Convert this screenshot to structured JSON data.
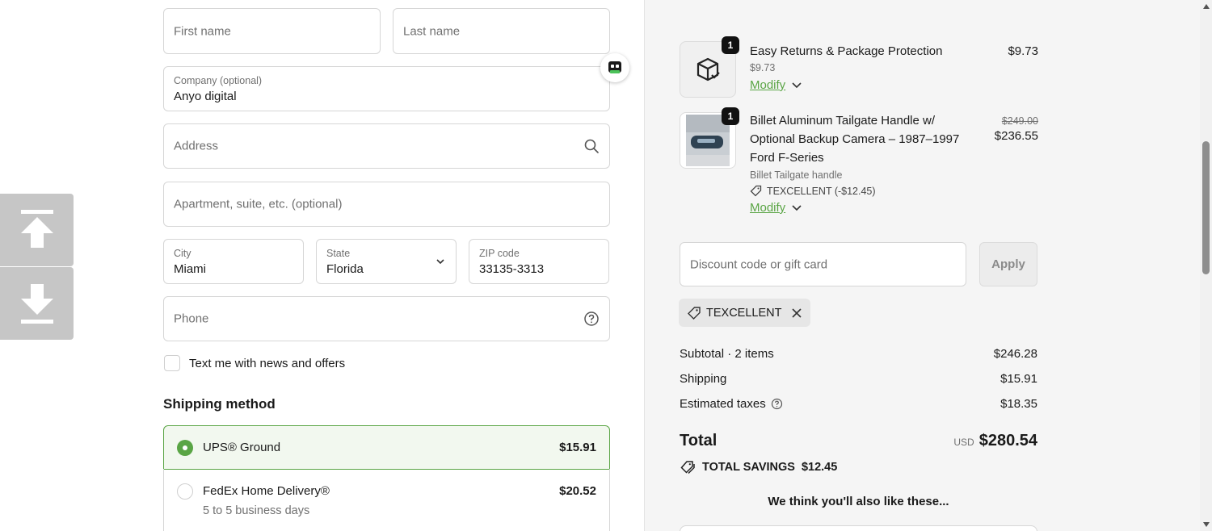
{
  "form": {
    "first_name": {
      "placeholder": "First name"
    },
    "last_name": {
      "placeholder": "Last name"
    },
    "company": {
      "label": "Company (optional)",
      "value": "Anyo digital"
    },
    "address": {
      "placeholder": "Address"
    },
    "apartment": {
      "placeholder": "Apartment, suite, etc. (optional)"
    },
    "city": {
      "label": "City",
      "value": "Miami"
    },
    "state": {
      "label": "State",
      "value": "Florida"
    },
    "zip": {
      "label": "ZIP code",
      "value": "33135-3313"
    },
    "phone": {
      "placeholder": "Phone"
    },
    "news_opt_in": {
      "label": "Text me with news and offers",
      "checked": false
    }
  },
  "shipping": {
    "title": "Shipping method",
    "options": [
      {
        "name": "UPS® Ground",
        "price": "$15.91",
        "selected": true
      },
      {
        "name": "FedEx Home Delivery®",
        "sub": "5 to 5 business days",
        "price": "$20.52",
        "selected": false
      }
    ]
  },
  "summary": {
    "items": [
      {
        "qty": "1",
        "name": "Easy Returns & Package Protection",
        "variant": "$9.73",
        "price": "$9.73",
        "modify": "Modify",
        "icon": "package-icon"
      },
      {
        "qty": "1",
        "name": "Billet Aluminum Tailgate Handle w/ Optional Backup Camera – 1987–1997 Ford F-Series",
        "variant": "Billet Tailgate handle",
        "discount": "TEXCELLENT (-$12.45)",
        "old_price": "$249.00",
        "price": "$236.55",
        "modify": "Modify"
      }
    ],
    "discount_placeholder": "Discount code or gift card",
    "apply_label": "Apply",
    "applied_code": "TEXCELLENT",
    "subtotal_label": "Subtotal · 2 items",
    "subtotal": "$246.28",
    "shipping_label": "Shipping",
    "shipping": "$15.91",
    "taxes_label": "Estimated taxes",
    "taxes": "$18.35",
    "total_label": "Total",
    "currency": "USD",
    "total": "$280.54",
    "savings_label": "TOTAL SAVINGS",
    "savings": "$12.45",
    "also_like": "We think you'll also like these..."
  },
  "colors": {
    "accent": "#5aa545",
    "summary_bg": "#f5f5f5"
  }
}
